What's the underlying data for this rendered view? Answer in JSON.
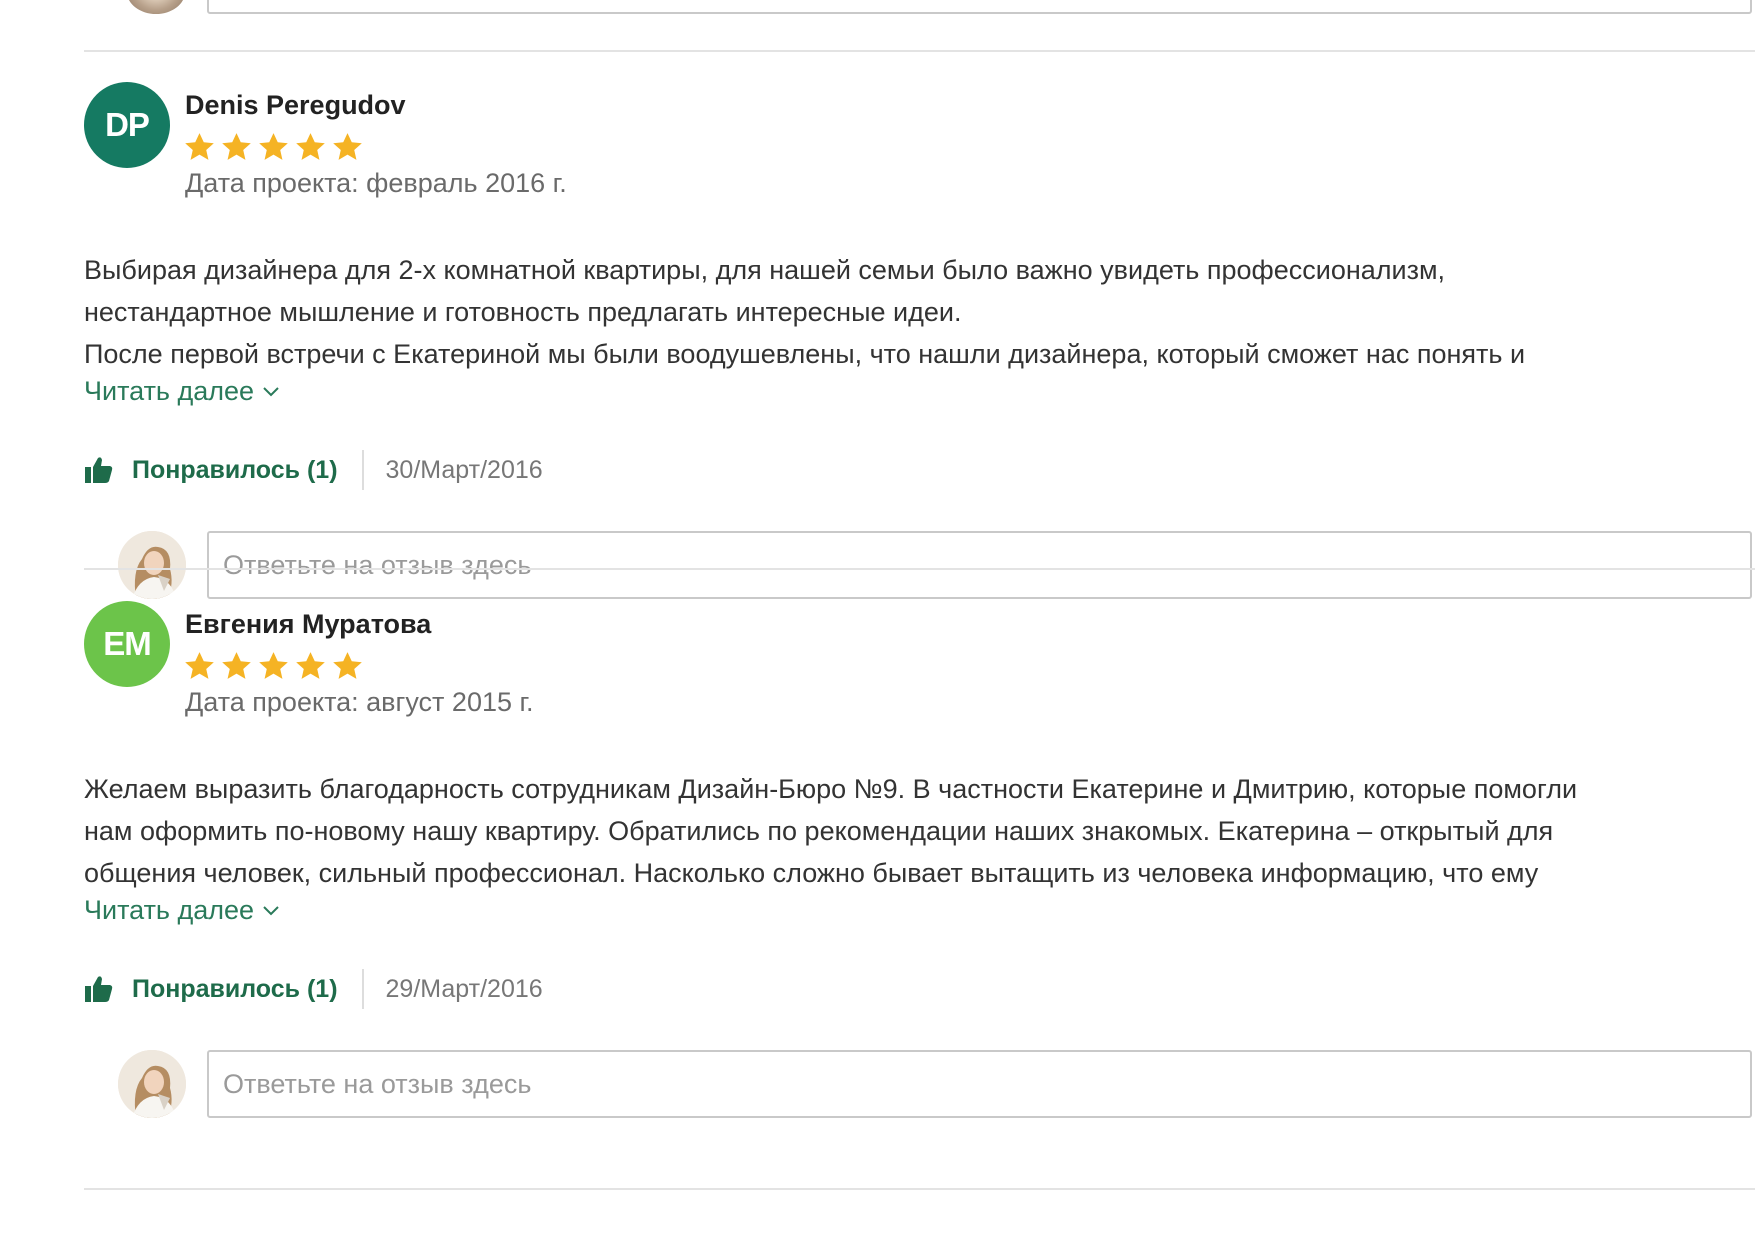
{
  "colors": {
    "accent_green": "#2a7a5a",
    "like_green": "#1e6b4a",
    "star_yellow": "#f5b324",
    "avatar_dp": "#157a62",
    "avatar_em": "#6cc44a",
    "divider": "#e3e3e3"
  },
  "reviews": [
    {
      "initials": "DP",
      "avatar_color": "#157a62",
      "name": "Denis Peregudov",
      "rating": 5,
      "project_date": "Дата проекта: февраль 2016 г.",
      "text_lines": [
        "Выбирая дизайнера для 2-х комнатной квартиры, для нашей семьи было важно увидеть профессионализм,",
        "нестандартное мышление и готовность предлагать интересные идеи.",
        "После первой встречи с Екатериной мы были воодушевлены, что нашли дизайнера, который сможет нас понять и"
      ],
      "read_more": "Читать далее",
      "like_label": "Понравилось (1)",
      "date": "30/Март/2016",
      "reply_placeholder": "Ответьте на отзыв здесь"
    },
    {
      "initials": "EM",
      "avatar_color": "#6cc44a",
      "name": "Евгения Муратова",
      "rating": 5,
      "project_date": "Дата проекта: август 2015 г.",
      "text_lines": [
        "Желаем выразить благодарность сотрудникам Дизайн-Бюро №9. В частности Екатерине и Дмитрию, которые помогли",
        "нам оформить по-новому нашу квартиру. Обратились по рекомендации наших знакомых. Екатерина – открытый для",
        "общения человек, сильный профессионал. Насколько сложно бывает вытащить из человека информацию, что ему"
      ],
      "read_more": "Читать далее",
      "like_label": "Понравилось (1)",
      "date": "29/Март/2016",
      "reply_placeholder": "Ответьте на отзыв здесь"
    }
  ],
  "icons": {
    "star": "star-icon",
    "like": "thumbs-up-icon",
    "chevron": "chevron-down-icon"
  }
}
